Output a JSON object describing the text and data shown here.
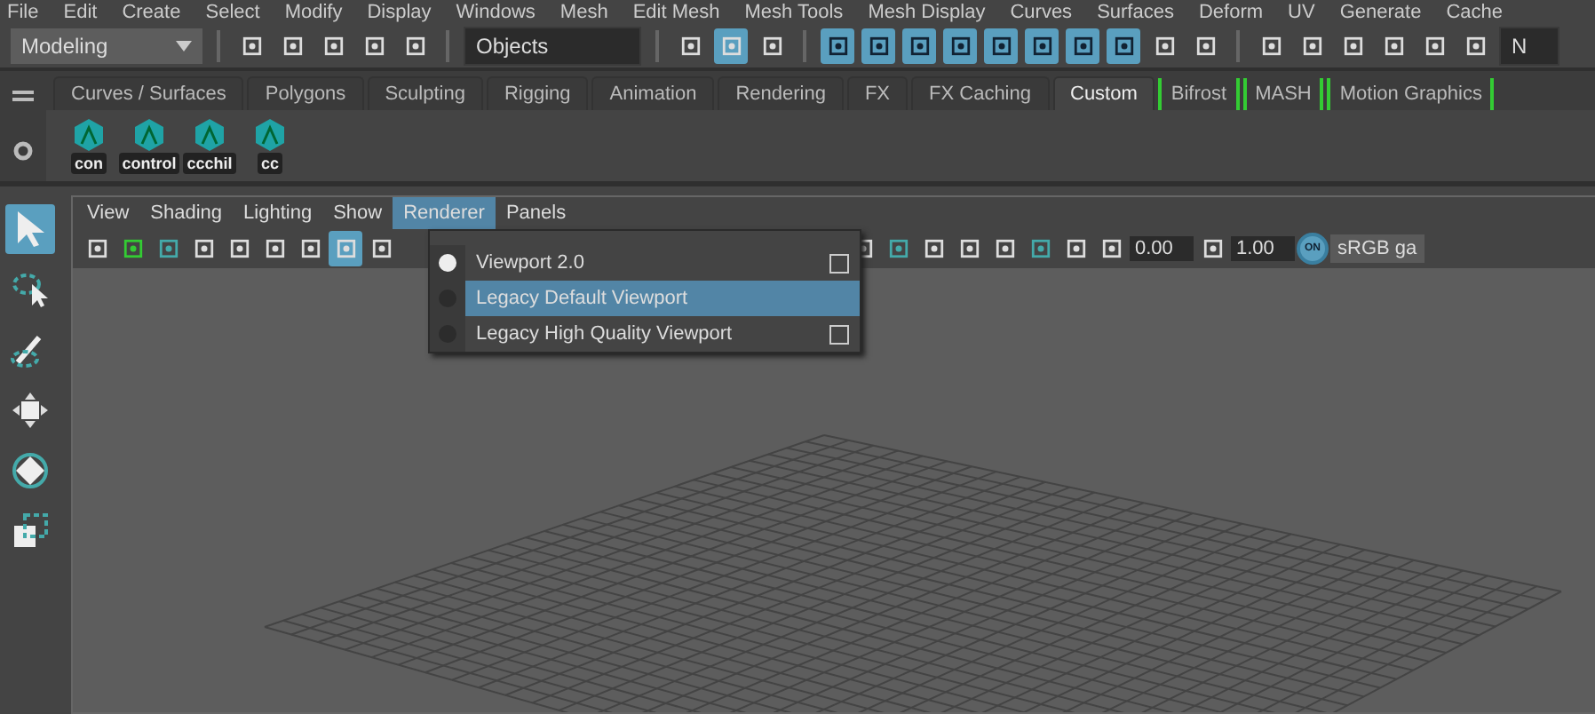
{
  "main_menu": [
    "File",
    "Edit",
    "Create",
    "Select",
    "Modify",
    "Display",
    "Windows",
    "Mesh",
    "Edit Mesh",
    "Mesh Tools",
    "Mesh Display",
    "Curves",
    "Surfaces",
    "Deform",
    "UV",
    "Generate",
    "Cache"
  ],
  "status_line": {
    "mode": "Modeling",
    "selection_mask": "Objects",
    "field_cut": "N"
  },
  "shelf_tabs": [
    {
      "label": "Curves / Surfaces",
      "selected": false,
      "kind": "tab"
    },
    {
      "label": "Polygons",
      "selected": false,
      "kind": "tab"
    },
    {
      "label": "Sculpting",
      "selected": false,
      "kind": "tab"
    },
    {
      "label": "Rigging",
      "selected": false,
      "kind": "tab"
    },
    {
      "label": "Animation",
      "selected": false,
      "kind": "tab"
    },
    {
      "label": "Rendering",
      "selected": false,
      "kind": "tab"
    },
    {
      "label": "FX",
      "selected": false,
      "kind": "tab"
    },
    {
      "label": "FX Caching",
      "selected": false,
      "kind": "tab"
    },
    {
      "label": "Custom",
      "selected": true,
      "kind": "tab"
    },
    {
      "label": "Bifrost",
      "selected": false,
      "kind": "bracketed"
    },
    {
      "label": "MASH",
      "selected": false,
      "kind": "bracketed"
    },
    {
      "label": "Motion Graphics",
      "selected": false,
      "kind": "bracketed"
    }
  ],
  "shelf_buttons": [
    "con",
    "control",
    "ccchil",
    "cc"
  ],
  "panel_menu": [
    {
      "label": "View",
      "selected": false
    },
    {
      "label": "Shading",
      "selected": false
    },
    {
      "label": "Lighting",
      "selected": false
    },
    {
      "label": "Show",
      "selected": false
    },
    {
      "label": "Renderer",
      "selected": true
    },
    {
      "label": "Panels",
      "selected": false
    }
  ],
  "panel_toolbar": {
    "exposure": "0.00",
    "gamma": "1.00",
    "view_transform_toggle": "ON",
    "color_space": "sRGB ga"
  },
  "renderer_menu": [
    {
      "label": "Viewport 2.0",
      "selected": true,
      "highlighted": false,
      "option_box": true
    },
    {
      "label": "Legacy Default Viewport",
      "selected": false,
      "highlighted": true,
      "option_box": false
    },
    {
      "label": "Legacy High Quality Viewport",
      "selected": false,
      "highlighted": false,
      "option_box": true
    }
  ]
}
